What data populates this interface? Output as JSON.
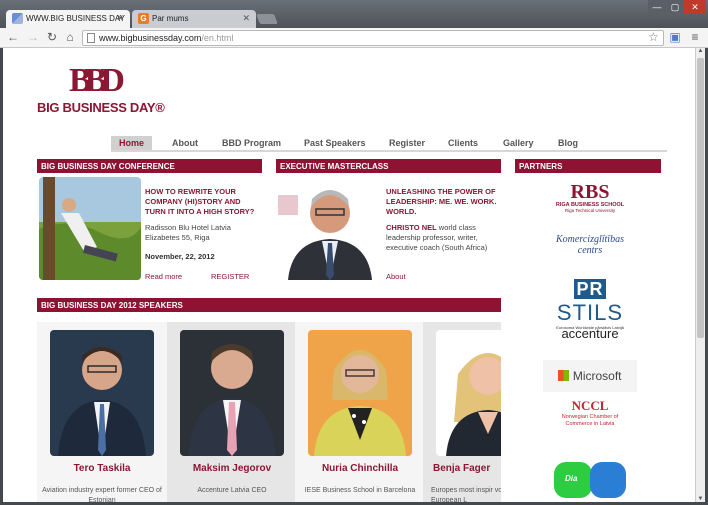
{
  "browser": {
    "tabs": [
      {
        "title": "WWW.BIG BUSINESS DAY"
      },
      {
        "title": "Par mums"
      }
    ],
    "url_host": "www.bigbusinessday.com",
    "url_path": "/en.html",
    "window_controls": {
      "minimize": "—",
      "maximize": "▢",
      "close": "✕"
    }
  },
  "site": {
    "logo_mark": "BBD",
    "logo_text": "BIG BUSINESS DAY®",
    "nav": [
      "Home",
      "About",
      "BBD Program",
      "Past Speakers",
      "Register",
      "Clients",
      "Gallery",
      "Blog"
    ]
  },
  "conference": {
    "header": "BIG BUSINESS DAY CONFERENCE",
    "title": "HOW TO REWRITE YOUR COMPANY (HI)STORY AND TURN IT INTO A HIGH STORY?",
    "address": "Radisson Blu Hotel Latvia Elizabetes 55, Riga",
    "date": "November, 22, 2012",
    "read_more": "Read more",
    "register": "REGISTER"
  },
  "masterclass": {
    "header": "EXECUTIVE MASTERCLASS",
    "title": "UNLEASHING THE POWER OF LEADERSHIP: ME. WE. WORK. WORLD.",
    "speaker": "CHRISTO NEL",
    "speaker_desc": " world class leadership professor, writer, executive coach (South Africa)",
    "about": "About"
  },
  "partners": {
    "header": "PARTNERS",
    "rbs": "RBS",
    "rbs_sub": "RIGA BUSINESS SCHOOL",
    "rbs_sub2": "Riga Technical University",
    "komerc": "Komercizglītības centrs",
    "stils": "STILS",
    "stils_sub": "Eurosoma Worldwide pārstāvis Latvijā",
    "accenture": "accenture",
    "microsoft": "Microsoft",
    "nccl": "NCCL",
    "nccl_sub": "Norwegian Chamber of Commerce in Latvia",
    "dia": "Dia"
  },
  "speakers": {
    "header": "BIG BUSINESS DAY 2012 SPEAKERS",
    "items": [
      {
        "name": "Tero Taskila",
        "desc": "Aviation industry expert former CEO of Estonian"
      },
      {
        "name": "Maksim Jegorov",
        "desc": "Accenture Latvia CEO"
      },
      {
        "name": "Nuria Chinchilla",
        "desc": "IESE Business School in Barcelona"
      },
      {
        "name": "Benja Fager",
        "desc": "Europes most inspir voted by European L"
      }
    ]
  },
  "colors": {
    "brand": "#8a1733",
    "header_bg": "#8e1232"
  }
}
